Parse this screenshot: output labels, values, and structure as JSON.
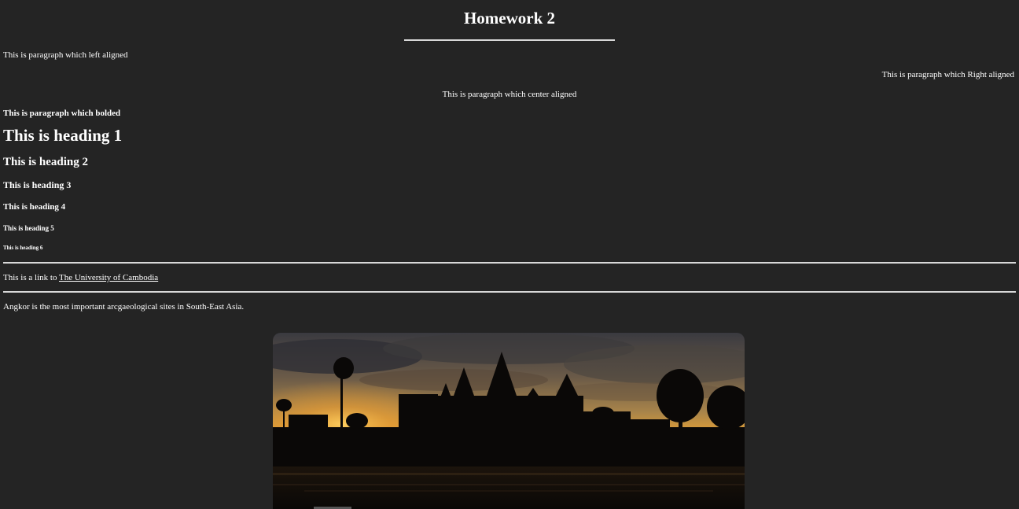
{
  "title": "Homework 2",
  "paragraphs": {
    "left": "This is paragraph which left aligned",
    "right": "This is paragraph which Right aligned",
    "center": "This is paragraph which center aligned",
    "bold": "This is paragraph which bolded"
  },
  "headings": {
    "h1": "This is heading 1",
    "h2": "This is heading 2",
    "h3": "This is heading 3",
    "h4": "This is heading 4",
    "h5": "This is heading 5",
    "h6": "This is heading 6"
  },
  "link_section": {
    "prefix": "This is a link to ",
    "link_text": "The University of Cambodia"
  },
  "angkor_text": "Angkor is the most important arcgaeological sites in South-East Asia.",
  "colors": {
    "background": "#242424",
    "text": "#ffffff",
    "rule": "#d8d8d8"
  }
}
